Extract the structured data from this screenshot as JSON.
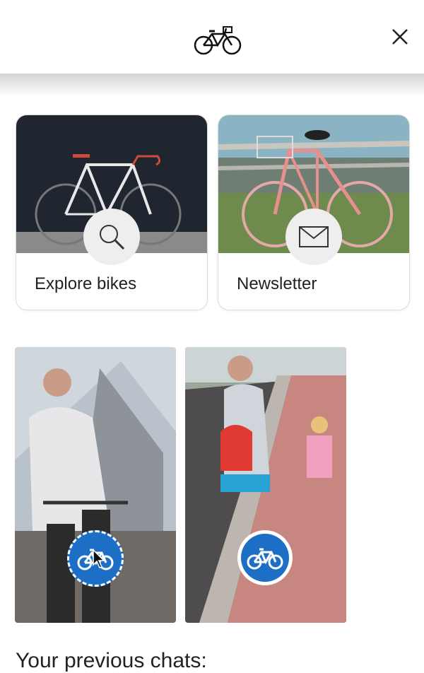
{
  "header": {
    "logo_icon": "bicycle-icon",
    "close_icon": "close-icon"
  },
  "cards": [
    {
      "label": "Explore bikes",
      "icon": "search-icon"
    },
    {
      "label": "Newsletter",
      "icon": "envelope-icon"
    }
  ],
  "tiles": [
    {
      "icon": "bicycle-sign-icon"
    },
    {
      "icon": "bicycle-sign-icon"
    }
  ],
  "previous_chats": {
    "heading": "Your previous chats:"
  },
  "colors": {
    "sign_blue": "#1d6fc6",
    "card_border": "#dcdcdc"
  }
}
